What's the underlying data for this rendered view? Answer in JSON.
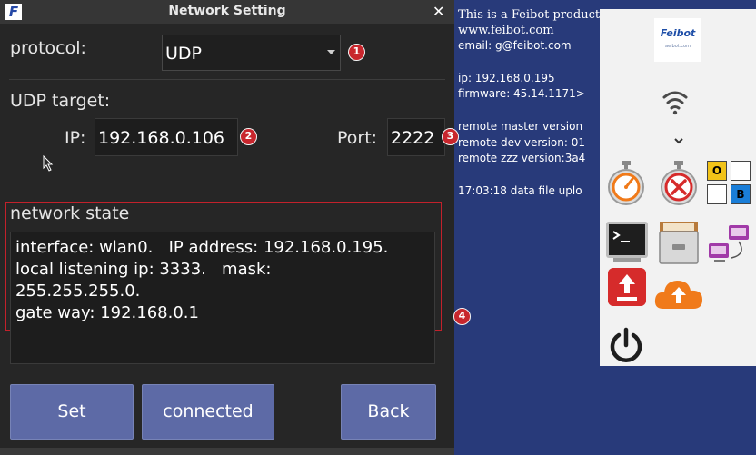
{
  "dialog": {
    "title": "Network Setting",
    "app_icon": "F",
    "close_icon": "✕",
    "protocol_label": "protocol:",
    "protocol_value": "UDP",
    "udp_target_label": "UDP target:",
    "ip_label": "IP:",
    "ip_value": "192.168.0.106",
    "port_label": "Port:",
    "port_value": "2222",
    "network_state_label": "network state",
    "network_state_lines": [
      "interface: wlan0.   IP address: 192.168.0.195.",
      "local listening ip: 3333.   mask:",
      "255.255.255.0.",
      "gate way: 192.168.0.1"
    ],
    "buttons": {
      "set": "Set",
      "connected": "connected",
      "back": "Back"
    },
    "badges": [
      "1",
      "2",
      "3",
      "4"
    ]
  },
  "desktop_info": {
    "line1": "This is a Feibot product",
    "line2": "www.feibot.com",
    "line3": "email: g@feibot.com",
    "ip": "ip: 192.168.0.195",
    "firmware": "firmware: 45.14.1171>",
    "remote_master": "remote master version",
    "remote_dev": "remote dev version: 01",
    "remote_zzz": "remote zzz version:3a4",
    "data_file": "17:03:18 data file uplo"
  },
  "launcher": {
    "logo_text": "Feibot",
    "logo_sub": "aeibot.com",
    "tile_o": "O",
    "tile_b": "B",
    "icons": [
      "wifi-icon",
      "chevron-down-icon",
      "stopwatch-icon",
      "cancel-timer-icon",
      "terminal-icon",
      "file-cabinet-icon",
      "network-transfer-icon",
      "upload-icon",
      "cloud-upload-icon",
      "power-icon"
    ],
    "colors": {
      "orange": "#f07a1a",
      "red": "#d62b2b",
      "yellow": "#f2c318",
      "blue": "#1a7ed8",
      "purple": "#a13aa8"
    }
  }
}
